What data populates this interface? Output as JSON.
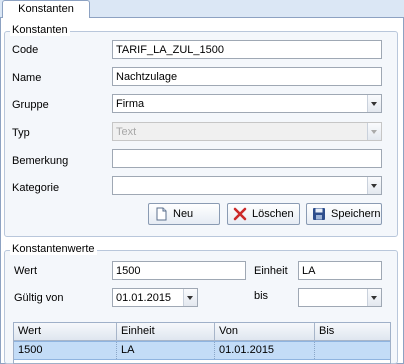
{
  "tab": {
    "label": "Konstanten"
  },
  "konstanten": {
    "legend": "Konstanten",
    "code": {
      "label": "Code",
      "value": "TARIF_LA_ZUL_1500"
    },
    "name": {
      "label": "Name",
      "value": "Nachtzulage"
    },
    "gruppe": {
      "label": "Gruppe",
      "value": "Firma"
    },
    "typ": {
      "label": "Typ",
      "value": "Text"
    },
    "bemerkung": {
      "label": "Bemerkung",
      "value": ""
    },
    "kategorie": {
      "label": "Kategorie",
      "value": ""
    },
    "buttons": {
      "neu": "Neu",
      "loeschen": "Löschen",
      "speichern": "Speichern"
    }
  },
  "werte": {
    "legend": "Konstantenwerte",
    "wert": {
      "label": "Wert",
      "value": "1500"
    },
    "einheit": {
      "label": "Einheit",
      "value": "LA"
    },
    "gueltig_von": {
      "label": "Gültig von",
      "value": "01.01.2015"
    },
    "bis": {
      "label": "bis",
      "value": " .  ."
    }
  },
  "grid": {
    "columns": [
      "Wert",
      "Einheit",
      "Von",
      "Bis"
    ],
    "rows": [
      [
        "1500",
        "LA",
        "01.01.2015",
        ""
      ]
    ]
  },
  "colors": {
    "accent": "#c3dcf7",
    "delete_icon": "#cc2a2a",
    "save_icon": "#2d4d8c"
  }
}
